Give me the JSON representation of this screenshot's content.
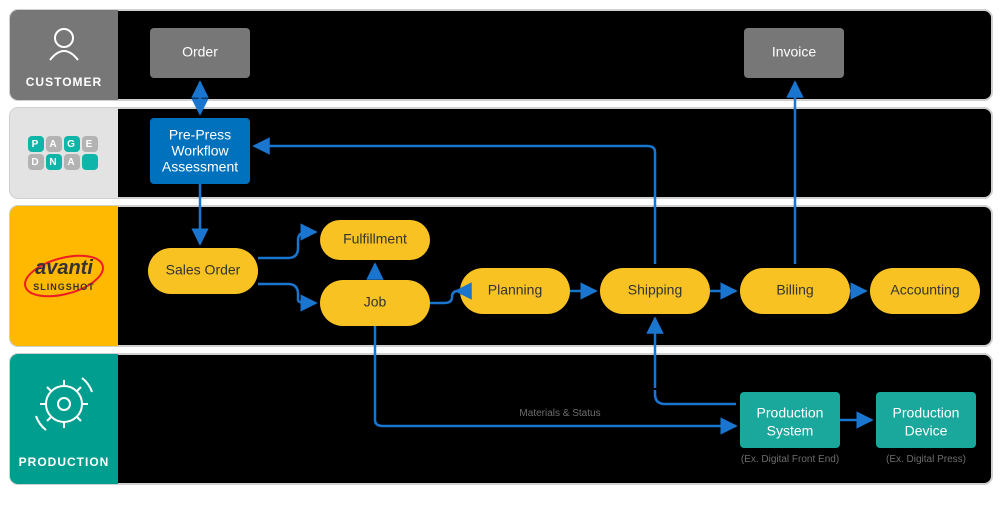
{
  "lanes": {
    "customer": {
      "label": "CUSTOMER"
    },
    "pagedna": {
      "label": "PAGEDNA"
    },
    "avanti": {
      "brand_top": "avanti",
      "brand_bottom": "SLINGSHOT"
    },
    "production": {
      "label": "PRODUCTION"
    }
  },
  "nodes": {
    "order": {
      "label": "Order"
    },
    "invoice": {
      "label": "Invoice"
    },
    "prepress_l1": "Pre-Press",
    "prepress_l2": "Workflow",
    "prepress_l3": "Assessment",
    "sales_order": {
      "label": "Sales Order"
    },
    "fulfillment": {
      "label": "Fulfillment"
    },
    "job": {
      "label": "Job"
    },
    "planning": {
      "label": "Planning"
    },
    "shipping": {
      "label": "Shipping"
    },
    "billing": {
      "label": "Billing"
    },
    "accounting": {
      "label": "Accounting"
    },
    "prod_sys_l1": "Production",
    "prod_sys_l2": "System",
    "prod_dev_l1": "Production",
    "prod_dev_l2": "Device"
  },
  "captions": {
    "materials_status": "Materials & Status",
    "ex_dfe": "(Ex. Digital Front End)",
    "ex_press": "(Ex. Digital Press)"
  },
  "colors": {
    "black": "#000000",
    "dark_gray_lane": "#e3e3e3",
    "orange_lane": "#ffb900",
    "teal_lane": "#009e8e",
    "box_gray": "#777777",
    "pill_yellow": "#f8c322",
    "box_blue_dk": "#0071bc",
    "box_teal": "#1aa79c",
    "arrow_blue": "#1a75cf",
    "lane_border": "#d0d0d0",
    "hex_teal": "#0fb5a8",
    "hex_gray": "#b3b3b3",
    "avanti_red": "#ed1c24"
  }
}
